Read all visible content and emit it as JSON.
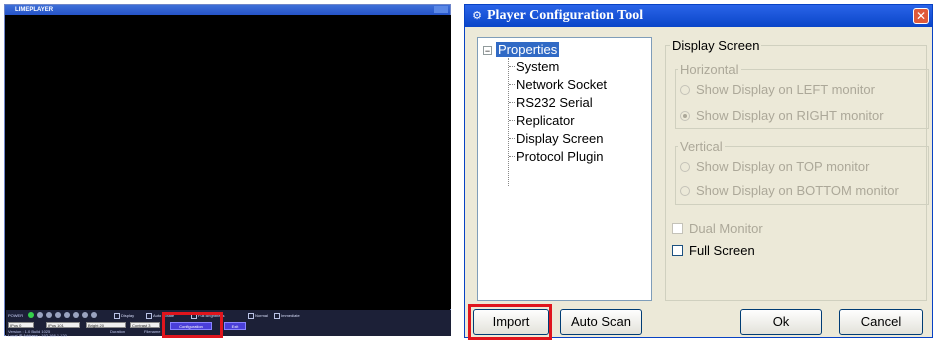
{
  "player": {
    "title": "LIMEPLAYER",
    "controls": {
      "power_label": "POWER",
      "options": [
        "Display",
        "Auto Rotate",
        "Full Brightness",
        "Normal",
        "Immediate"
      ],
      "fields": [
        "IPos 0",
        "IPos 101",
        "Bright 20",
        "Contrast 3"
      ],
      "configuration_label": "Configuration",
      "exit_label": "Exit",
      "version": "Version : 1.0 Build 1025",
      "ip": "Local IP Address : 192.168.1.120",
      "duration_label": "Duration",
      "filename_label": "Filename"
    }
  },
  "dialog": {
    "title": "Player Configuration Tool",
    "close_label": "✕",
    "tree": {
      "root": "Properties",
      "expander": "−",
      "items": [
        "System",
        "Network Socket",
        "RS232 Serial",
        "Replicator",
        "Display Screen",
        "Protocol Plugin"
      ]
    },
    "display_screen": {
      "title": "Display Screen",
      "horizontal": {
        "title": "Horizontal",
        "options": [
          "Show Display on LEFT monitor",
          "Show Display on RIGHT monitor"
        ],
        "selected": 1
      },
      "vertical": {
        "title": "Vertical",
        "options": [
          "Show Display on TOP monitor",
          "Show Display on BOTTOM monitor"
        ]
      },
      "dual_monitor": "Dual Monitor",
      "full_screen": "Full Screen"
    },
    "buttons": {
      "import": "Import",
      "auto_scan": "Auto Scan",
      "ok": "Ok",
      "cancel": "Cancel"
    }
  },
  "colors": {
    "highlight": "#e0151d",
    "titlebar": "#0a45c8",
    "selection": "#316ac5"
  }
}
